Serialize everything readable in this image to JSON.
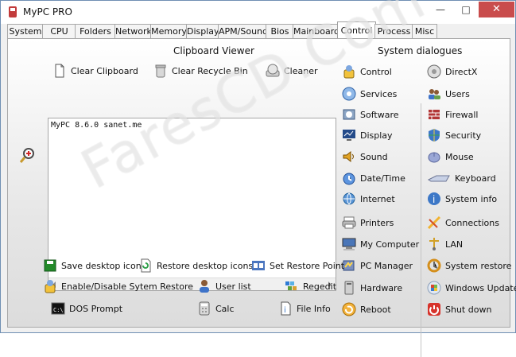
{
  "window": {
    "title": "MyPC PRO"
  },
  "titlebar": {
    "minimize": "—",
    "maximize": "□",
    "close": "✕"
  },
  "tabs": [
    "System",
    "CPU",
    "Folders",
    "Network",
    "Memory",
    "Display",
    "APM/Sound",
    "Bios",
    "Mainboard",
    "Control",
    "Process",
    "Misc"
  ],
  "clipboard": {
    "heading": "Clipboard Viewer",
    "clear_clipboard": "Clear Clipboard",
    "clear_recycle_bin": "Clear Recycle Bin",
    "cleaner": "Cleaner",
    "content": "MyPC 8.6.0 sanet.me"
  },
  "system_dialogues": {
    "heading": "System dialogues",
    "left": [
      "Control",
      "Services",
      "Software",
      "Display",
      "Sound",
      "Date/Time",
      "Internet",
      "Printers",
      "My Computer",
      "PC Manager",
      "Hardware",
      "Reboot"
    ],
    "right": [
      "DirectX",
      "Users",
      "Firewall",
      "Security",
      "Mouse",
      "Keyboard",
      "System info",
      "Connections",
      "LAN",
      "System restore",
      "Windows Update",
      "Shut down"
    ]
  },
  "bottom_actions": {
    "save_desktop_icons": "Save desktop icons",
    "restore_desktop_icons": "Restore desktop  icons",
    "set_restore_point": "Set Restore Point",
    "enable_disable_restore": "Enable/Disable Sytem Restore",
    "user_list": "User list",
    "regedit": "Regedit",
    "dos_prompt": "DOS Prompt",
    "calc": "Calc",
    "file_info": "File Info"
  },
  "watermark": "FaresCD.Com"
}
